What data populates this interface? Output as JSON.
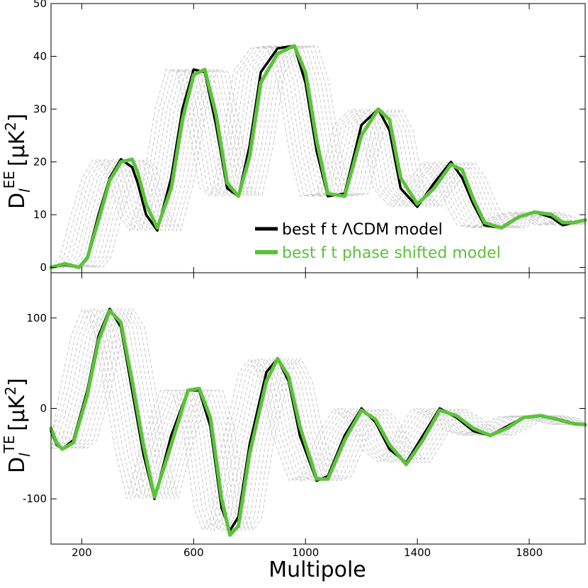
{
  "xlabel": "Multipole",
  "chart_data": [
    {
      "type": "line",
      "panel": "top",
      "ylabel_main": "D",
      "ylabel_sub": "l",
      "ylabel_sup": "EE",
      "ylabel_unit": "[μK",
      "ylabel_unit_sup": "2",
      "ylabel_unit_close": "]",
      "xlim": [
        90,
        2000
      ],
      "ylim": [
        -1,
        50
      ],
      "yticks": [
        0,
        10,
        20,
        30,
        40,
        50
      ],
      "xticks": [
        200,
        600,
        1000,
        1400,
        1800
      ],
      "grid": false,
      "legend_position": "bottom-center",
      "series": [
        {
          "name": "best f t ΛCDM model",
          "color": "#000000",
          "x": [
            90,
            140,
            190,
            220,
            260,
            300,
            340,
            380,
            400,
            430,
            470,
            520,
            560,
            600,
            640,
            680,
            720,
            760,
            800,
            840,
            900,
            960,
            1000,
            1040,
            1080,
            1140,
            1200,
            1260,
            1300,
            1340,
            1400,
            1460,
            1520,
            1560,
            1600,
            1640,
            1700,
            1760,
            1820,
            1880,
            1920,
            1960,
            2000
          ],
          "y": [
            0,
            0.5,
            0,
            2,
            10,
            17,
            20.5,
            19,
            16,
            10,
            7,
            17,
            30,
            37.5,
            37,
            27,
            15,
            13.5,
            23,
            37,
            41.5,
            42,
            35,
            22,
            13.5,
            14,
            27,
            30,
            26,
            15,
            11.5,
            16,
            20,
            17,
            12,
            8,
            7.5,
            9.5,
            10.5,
            9.5,
            8,
            8.5,
            9
          ]
        },
        {
          "name": "best f t phase shifted model",
          "color": "#5cc23a",
          "x": [
            90,
            140,
            190,
            220,
            260,
            300,
            340,
            380,
            400,
            430,
            470,
            520,
            560,
            600,
            640,
            680,
            720,
            760,
            800,
            840,
            900,
            960,
            1000,
            1040,
            1080,
            1140,
            1200,
            1260,
            1300,
            1340,
            1400,
            1460,
            1520,
            1560,
            1600,
            1640,
            1700,
            1760,
            1820,
            1880,
            1920,
            1960,
            2000
          ],
          "y": [
            0,
            0.7,
            0,
            1.8,
            9,
            16.5,
            20,
            20.5,
            18,
            12,
            7.5,
            15,
            28,
            36.5,
            37.5,
            29,
            16,
            13.5,
            21,
            35,
            40.5,
            42,
            37,
            24,
            14,
            13.5,
            25,
            30,
            28,
            17,
            12,
            15,
            19.5,
            18.5,
            13,
            8.5,
            7.5,
            9.5,
            10.5,
            10,
            8.5,
            8.5,
            9
          ]
        }
      ]
    },
    {
      "type": "line",
      "panel": "bottom",
      "ylabel_main": "D",
      "ylabel_sub": "l",
      "ylabel_sup": "TE",
      "ylabel_unit": "[μK",
      "ylabel_unit_sup": "2",
      "ylabel_unit_close": "]",
      "xlim": [
        90,
        2000
      ],
      "ylim": [
        -150,
        150
      ],
      "yticks": [
        -100,
        0,
        100
      ],
      "xticks": [
        200,
        600,
        1000,
        1400,
        1800
      ],
      "grid": false,
      "series": [
        {
          "name": "best f t ΛCDM model",
          "color": "#000000",
          "x": [
            90,
            110,
            130,
            170,
            220,
            260,
            300,
            340,
            380,
            420,
            460,
            520,
            580,
            620,
            660,
            700,
            730,
            760,
            800,
            860,
            900,
            940,
            980,
            1040,
            1080,
            1140,
            1200,
            1250,
            1300,
            1360,
            1420,
            1480,
            1540,
            1600,
            1660,
            1720,
            1780,
            1840,
            1900,
            1960,
            2000
          ],
          "y": [
            -25,
            -40,
            -45,
            -35,
            20,
            80,
            110,
            90,
            20,
            -50,
            -100,
            -30,
            20,
            20,
            -20,
            -110,
            -135,
            -120,
            -40,
            40,
            55,
            30,
            -30,
            -80,
            -75,
            -30,
            0,
            -15,
            -45,
            -60,
            -30,
            0,
            -10,
            -25,
            -30,
            -20,
            -10,
            -8,
            -12,
            -17,
            -18
          ]
        },
        {
          "name": "best f t phase shifted model",
          "color": "#5cc23a",
          "x": [
            90,
            110,
            130,
            170,
            220,
            260,
            300,
            340,
            380,
            420,
            460,
            520,
            580,
            620,
            660,
            700,
            730,
            760,
            800,
            860,
            900,
            940,
            980,
            1040,
            1080,
            1140,
            1200,
            1250,
            1300,
            1360,
            1420,
            1480,
            1540,
            1600,
            1660,
            1720,
            1780,
            1840,
            1900,
            1960,
            2000
          ],
          "y": [
            -22,
            -38,
            -45,
            -38,
            15,
            75,
            108,
            95,
            30,
            -40,
            -98,
            -40,
            20,
            22,
            -10,
            -100,
            -140,
            -130,
            -50,
            30,
            55,
            35,
            -20,
            -78,
            -78,
            -35,
            -2,
            -12,
            -40,
            -62,
            -35,
            -2,
            -8,
            -22,
            -30,
            -22,
            -10,
            -8,
            -12,
            -17,
            -18
          ]
        }
      ]
    }
  ]
}
